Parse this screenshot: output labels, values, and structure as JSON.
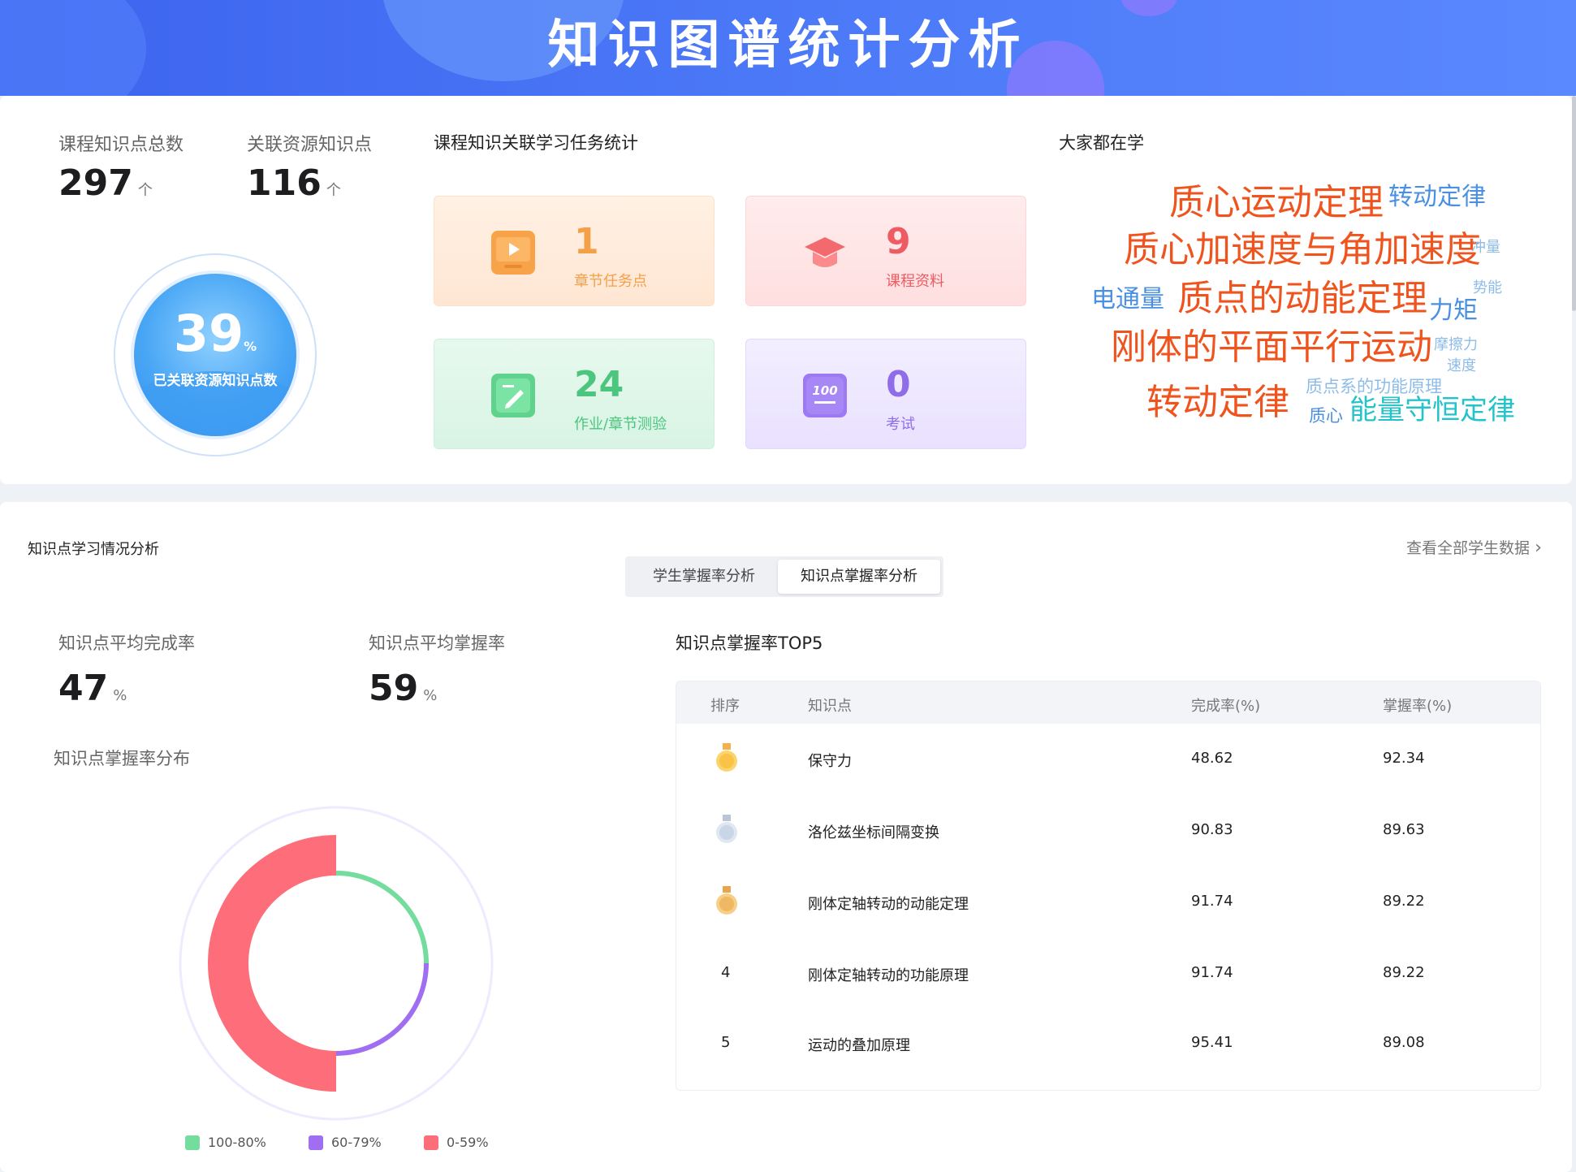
{
  "banner": {
    "title": "知识图谱统计分析"
  },
  "overview": {
    "total_points": {
      "label": "课程知识点总数",
      "value": "297",
      "unit": "个"
    },
    "linked_points": {
      "label": "关联资源知识点",
      "value": "116",
      "unit": "个"
    },
    "gauge": {
      "percent": "39",
      "percent_unit": "%",
      "caption": "已关联资源知识点数",
      "fraction": 0.39
    }
  },
  "tasks": {
    "title": "课程知识关联学习任务统计",
    "items": [
      {
        "value": "1",
        "label": "章节任务点",
        "icon": "video-icon"
      },
      {
        "value": "9",
        "label": "课程资料",
        "icon": "graduation-cap-icon"
      },
      {
        "value": "24",
        "label": "作业/章节测验",
        "icon": "edit-icon"
      },
      {
        "value": "0",
        "label": "考试",
        "icon": "exam-icon"
      }
    ]
  },
  "word_cloud": {
    "title": "大家都在学",
    "words": [
      "质心运动定理",
      "转动定律",
      "质心加速度与角加速度",
      "冲量",
      "势能",
      "电通量",
      "质点的动能定理",
      "力矩",
      "刚体的平面平行运动",
      "摩擦力",
      "速度",
      "质点系的功能原理",
      "转动定律",
      "质心",
      "能量守恒定律"
    ]
  },
  "analysis": {
    "title": "知识点学习情况分析",
    "view_all": "查看全部学生数据",
    "tabs": [
      "学生掌握率分析",
      "知识点掌握率分析"
    ],
    "avg_completion": {
      "label": "知识点平均完成率",
      "value": "47",
      "unit": "%"
    },
    "avg_mastery": {
      "label": "知识点平均掌握率",
      "value": "59",
      "unit": "%"
    },
    "distribution_title": "知识点掌握率分布",
    "top5_title": "知识点掌握率TOP5"
  },
  "chart_data": {
    "type": "pie",
    "title": "知识点掌握率分布",
    "categories": [
      "100-80%",
      "60-79%",
      "0-59%"
    ],
    "values": [
      25,
      25,
      50
    ],
    "colors": [
      "#74dc9c",
      "#a06ef0",
      "#fd6e7a"
    ]
  },
  "top5_table": {
    "columns": [
      "排序",
      "知识点",
      "完成率(%)",
      "掌握率(%)"
    ],
    "rows": [
      {
        "rank": "1",
        "name": "保守力",
        "completion": "48.62",
        "mastery": "92.34"
      },
      {
        "rank": "2",
        "name": "洛伦兹坐标间隔变换",
        "completion": "90.83",
        "mastery": "89.63"
      },
      {
        "rank": "3",
        "name": "刚体定轴转动的动能定理",
        "completion": "91.74",
        "mastery": "89.22"
      },
      {
        "rank": "4",
        "name": "刚体定轴转动的功能原理",
        "completion": "91.74",
        "mastery": "89.22"
      },
      {
        "rank": "5",
        "name": "运动的叠加原理",
        "completion": "95.41",
        "mastery": "89.08"
      }
    ]
  }
}
